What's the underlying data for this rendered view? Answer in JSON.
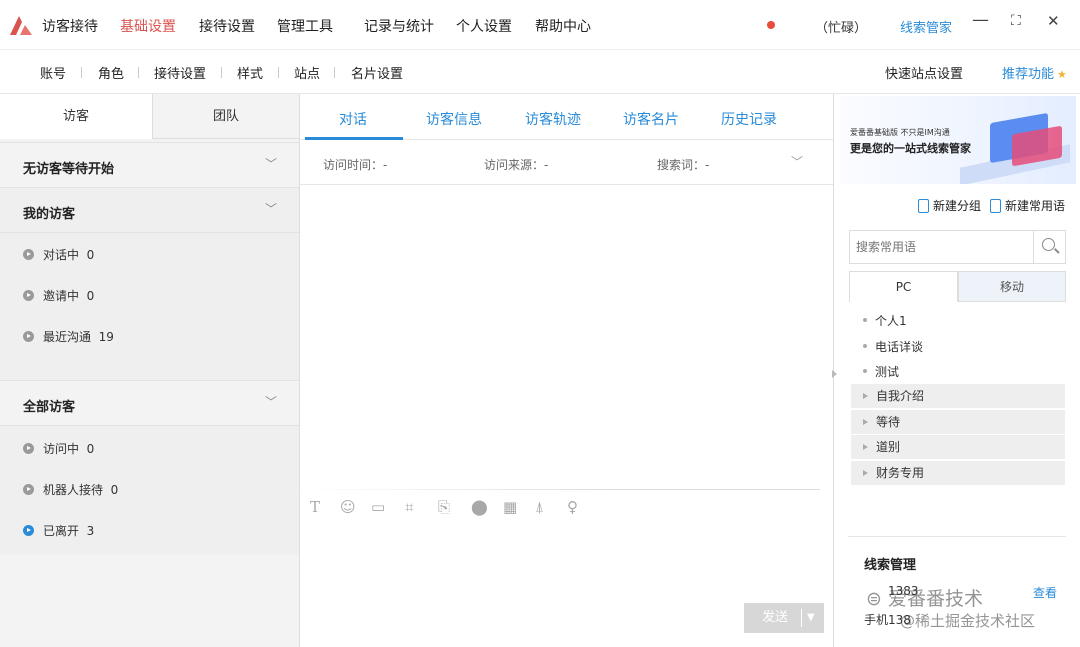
{
  "app": {
    "name": "访客接待"
  },
  "menu": [
    "基础设置",
    "接待设置",
    "管理工具",
    "记录与统计",
    "个人设置",
    "帮助中心"
  ],
  "status": {
    "text": "（忙碌）",
    "link": "线索管家",
    "color": "#e74c3c"
  },
  "window_controls": [
    "—",
    "⛶",
    "✕"
  ],
  "subnav": [
    "账号",
    "角色",
    "接待设置",
    "样式",
    "站点",
    "名片设置"
  ],
  "subnav_right": {
    "quick": "快速站点设置",
    "recommend": "推荐功能"
  },
  "left": {
    "tabs": [
      "访客",
      "团队"
    ],
    "sections": {
      "waiting": "无访客等待开始",
      "mine": "我的访客",
      "all": "全部访客"
    },
    "mine_items": [
      {
        "label": "对话中",
        "count": "0"
      },
      {
        "label": "邀请中",
        "count": "0"
      },
      {
        "label": "最近沟通",
        "count": "19"
      }
    ],
    "all_items": [
      {
        "label": "访问中",
        "count": "0"
      },
      {
        "label": "机器人接待",
        "count": "0"
      },
      {
        "label": "已离开",
        "count": "3"
      }
    ]
  },
  "main": {
    "tabs": [
      "对话",
      "访客信息",
      "访客轨迹",
      "访客名片",
      "历史记录"
    ],
    "info": {
      "visit_time": "访问时间：-",
      "source": "访问来源：-",
      "keyword": "搜索词：-"
    },
    "send": "发送"
  },
  "right": {
    "banner": {
      "line1": "爱番番基础版 不只是IM沟通",
      "line2": "更是您的一站式线索管家"
    },
    "new_group": "新建分组",
    "new_phrase": "新建常用语",
    "search_placeholder": "搜索常用语",
    "tabs": [
      "PC",
      "移动"
    ],
    "phrases": [
      "个人1",
      "电话详谈",
      "测试"
    ],
    "categories": [
      "自我介绍",
      "等待",
      "道别",
      "财务专用"
    ],
    "lead": {
      "title": "线索管理",
      "row1": "1383",
      "row2": "手机138",
      "link": "查看"
    }
  },
  "watermark": {
    "line1": "爱番番技术",
    "line2": "@稀土掘金技术社区"
  },
  "colors": {
    "accent": "#2a8bd8",
    "menu_active": "#d9534f",
    "logo": "#d9534f"
  }
}
